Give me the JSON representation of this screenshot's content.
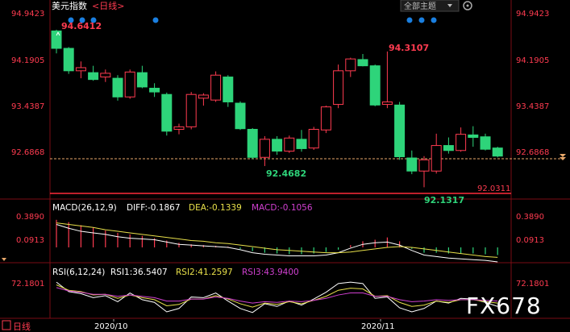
{
  "header": {
    "title": "美元指数",
    "period_label": "<日线>",
    "theme_button": "全部主题",
    "dropdown_icon": "chevron-down-icon",
    "settings_icon": "gear-icon"
  },
  "price_axis": {
    "labels": [
      "94.9423",
      "94.1905",
      "93.4387",
      "92.6868"
    ],
    "values": [
      94.9423,
      94.1905,
      93.4387,
      92.6868
    ]
  },
  "annotations": {
    "high_left": "94.6412",
    "high_mid": "94.3107",
    "low_left": "92.4682",
    "low_right": "92.1317",
    "line_level": "92.0311"
  },
  "macd": {
    "label": "MACD(26,12,9)",
    "diff": "DIFF:-0.1867",
    "dea": "DEA:-0.1339",
    "macd": "MACD:-0.1056",
    "axis_labels": [
      "0.3890",
      "0.0913"
    ],
    "axis_values": [
      0.389,
      0.0913
    ]
  },
  "rsi": {
    "label": "RSI(6,12,24)",
    "rsi1": "RSI1:36.5407",
    "rsi2": "RSI2:41.2597",
    "rsi3": "RSI3:43.9400",
    "axis_label": "72.1801",
    "axis_label_left": "72.1801",
    "axis_value": 72.1801
  },
  "footer": {
    "period": "日线",
    "dates": [
      "2020/10",
      "2020/11"
    ]
  },
  "watermark": "FX678",
  "colors": {
    "up": "#ff3b50",
    "down": "#2ed47a",
    "axis_text": "#ff3b50",
    "diff": "#ffffff",
    "dea": "#e8e04a",
    "macd": "#d040d0",
    "dot": "#1a7fe0"
  },
  "chart_data": {
    "type": "candlestick",
    "candles": [
      {
        "o": 94.64,
        "h": 94.66,
        "l": 94.28,
        "c": 94.36
      },
      {
        "o": 94.36,
        "h": 94.38,
        "l": 93.95,
        "c": 94.0
      },
      {
        "o": 94.0,
        "h": 94.15,
        "l": 93.88,
        "c": 94.05
      },
      {
        "o": 93.97,
        "h": 94.08,
        "l": 93.84,
        "c": 93.86
      },
      {
        "o": 93.9,
        "h": 94.02,
        "l": 93.82,
        "c": 93.96
      },
      {
        "o": 93.88,
        "h": 93.93,
        "l": 93.52,
        "c": 93.58
      },
      {
        "o": 93.58,
        "h": 94.02,
        "l": 93.55,
        "c": 93.98
      },
      {
        "o": 93.97,
        "h": 94.08,
        "l": 93.72,
        "c": 93.74
      },
      {
        "o": 93.72,
        "h": 93.8,
        "l": 93.58,
        "c": 93.66
      },
      {
        "o": 93.62,
        "h": 93.65,
        "l": 92.96,
        "c": 93.03
      },
      {
        "o": 93.06,
        "h": 93.15,
        "l": 92.98,
        "c": 93.1
      },
      {
        "o": 93.1,
        "h": 93.66,
        "l": 93.06,
        "c": 93.62
      },
      {
        "o": 93.56,
        "h": 93.64,
        "l": 93.44,
        "c": 93.61
      },
      {
        "o": 93.53,
        "h": 93.99,
        "l": 93.5,
        "c": 93.93
      },
      {
        "o": 93.9,
        "h": 93.93,
        "l": 93.42,
        "c": 93.5
      },
      {
        "o": 93.48,
        "h": 93.51,
        "l": 93.05,
        "c": 93.07
      },
      {
        "o": 93.06,
        "h": 93.08,
        "l": 92.58,
        "c": 92.61
      },
      {
        "o": 92.61,
        "h": 92.95,
        "l": 92.47,
        "c": 92.9
      },
      {
        "o": 92.9,
        "h": 92.95,
        "l": 92.65,
        "c": 92.71
      },
      {
        "o": 92.71,
        "h": 92.96,
        "l": 92.68,
        "c": 92.92
      },
      {
        "o": 92.9,
        "h": 93.05,
        "l": 92.7,
        "c": 92.75
      },
      {
        "o": 92.76,
        "h": 93.1,
        "l": 92.73,
        "c": 93.06
      },
      {
        "o": 93.05,
        "h": 93.44,
        "l": 93.0,
        "c": 93.42
      },
      {
        "o": 93.46,
        "h": 94.1,
        "l": 93.4,
        "c": 94.0
      },
      {
        "o": 94.0,
        "h": 94.21,
        "l": 93.9,
        "c": 94.19
      },
      {
        "o": 94.18,
        "h": 94.27,
        "l": 94.07,
        "c": 94.08
      },
      {
        "o": 94.08,
        "h": 94.1,
        "l": 93.43,
        "c": 93.45
      },
      {
        "o": 93.46,
        "h": 94.31,
        "l": 93.4,
        "c": 93.5
      },
      {
        "o": 93.45,
        "h": 93.5,
        "l": 92.57,
        "c": 92.62
      },
      {
        "o": 92.6,
        "h": 92.72,
        "l": 92.34,
        "c": 92.39
      },
      {
        "o": 92.39,
        "h": 92.63,
        "l": 92.13,
        "c": 92.57
      },
      {
        "o": 92.39,
        "h": 92.99,
        "l": 92.35,
        "c": 92.8
      },
      {
        "o": 92.8,
        "h": 92.93,
        "l": 92.67,
        "c": 92.72
      },
      {
        "o": 92.72,
        "h": 93.09,
        "l": 92.7,
        "c": 92.98
      },
      {
        "o": 92.97,
        "h": 93.11,
        "l": 92.78,
        "c": 92.93
      },
      {
        "o": 92.94,
        "h": 92.99,
        "l": 92.72,
        "c": 92.74
      },
      {
        "o": 92.76,
        "h": 92.78,
        "l": 92.61,
        "c": 92.63
      }
    ],
    "macd_hist": [
      0.36,
      0.33,
      0.29,
      0.26,
      0.22,
      0.19,
      0.17,
      0.15,
      0.12,
      0.09,
      0.06,
      0.04,
      0.03,
      0.02,
      0.01,
      -0.02,
      -0.05,
      -0.07,
      -0.08,
      -0.09,
      -0.09,
      -0.08,
      -0.06,
      -0.03,
      0.03,
      0.08,
      0.1,
      0.13,
      0.08,
      -0.02,
      -0.07,
      -0.07,
      -0.08,
      -0.08,
      -0.08,
      -0.09,
      -0.1
    ],
    "macd_diff": [
      0.3,
      0.25,
      0.21,
      0.19,
      0.17,
      0.14,
      0.12,
      0.11,
      0.1,
      0.07,
      0.04,
      0.03,
      0.02,
      0.01,
      0.0,
      -0.03,
      -0.07,
      -0.09,
      -0.1,
      -0.11,
      -0.11,
      -0.11,
      -0.1,
      -0.07,
      -0.01,
      0.04,
      0.06,
      0.07,
      0.03,
      -0.04,
      -0.1,
      -0.12,
      -0.14,
      -0.15,
      -0.16,
      -0.17,
      -0.19
    ],
    "macd_dea": [
      0.32,
      0.3,
      0.28,
      0.26,
      0.23,
      0.21,
      0.19,
      0.17,
      0.15,
      0.13,
      0.11,
      0.09,
      0.08,
      0.06,
      0.05,
      0.03,
      0.01,
      -0.01,
      -0.03,
      -0.04,
      -0.05,
      -0.06,
      -0.07,
      -0.07,
      -0.06,
      -0.04,
      -0.02,
      0.0,
      0.01,
      0.0,
      -0.02,
      -0.04,
      -0.06,
      -0.08,
      -0.1,
      -0.12,
      -0.13
    ],
    "rsi1": [
      72,
      58,
      55,
      49,
      52,
      43,
      56,
      46,
      42,
      28,
      33,
      50,
      49,
      56,
      44,
      33,
      27,
      40,
      36,
      44,
      38,
      47,
      57,
      70,
      72,
      70,
      48,
      50,
      34,
      28,
      33,
      44,
      41,
      48,
      47,
      42,
      36
    ],
    "rsi2": [
      68,
      60,
      58,
      53,
      54,
      48,
      53,
      49,
      46,
      37,
      39,
      47,
      47,
      52,
      47,
      40,
      35,
      41,
      39,
      43,
      40,
      45,
      51,
      60,
      63,
      62,
      51,
      52,
      42,
      36,
      38,
      44,
      42,
      46,
      46,
      43,
      41
    ],
    "rsi3": [
      64,
      59,
      57,
      54,
      54,
      51,
      53,
      51,
      49,
      44,
      44,
      47,
      47,
      50,
      48,
      44,
      41,
      43,
      42,
      44,
      43,
      45,
      48,
      53,
      56,
      56,
      51,
      51,
      46,
      43,
      44,
      46,
      45,
      46,
      46,
      45,
      44
    ],
    "ylim_price": [
      92.0311,
      94.9423
    ],
    "ylim_rsi": [
      22,
      72.1801
    ],
    "x_tick_labels": [
      "2020/10",
      "2020/11"
    ]
  }
}
